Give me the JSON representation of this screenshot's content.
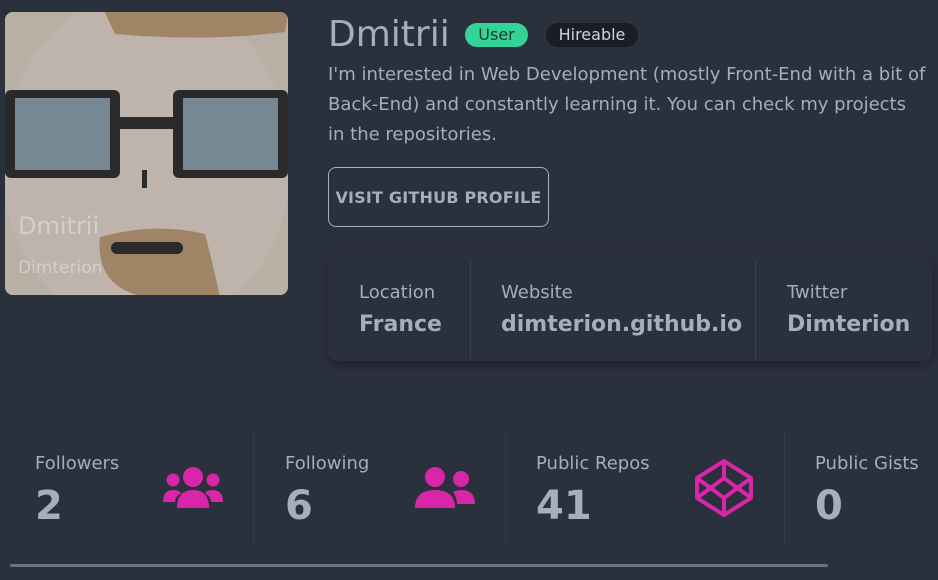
{
  "profile": {
    "name": "Dmitrii",
    "login": "Dimterion",
    "badges": {
      "type": "User",
      "hireable": "Hireable"
    },
    "bio": "I'm interested in Web Development (mostly Front-End with a bit of Back-End) and constantly learning it. You can check my projects in the repositories.",
    "github_button": "VISIT GITHUB PROFILE"
  },
  "info": [
    {
      "label": "Location",
      "value": "France"
    },
    {
      "label": "Website",
      "value": "dimterion.github.io"
    },
    {
      "label": "Twitter",
      "value": "Dimterion"
    }
  ],
  "stats": [
    {
      "label": "Followers",
      "value": "2",
      "icon": "users-icon"
    },
    {
      "label": "Following",
      "value": "6",
      "icon": "user-friends-icon"
    },
    {
      "label": "Public Repos",
      "value": "41",
      "icon": "codepen-icon"
    },
    {
      "label": "Public Gists",
      "value": "0",
      "icon": "store-icon"
    }
  ],
  "colors": {
    "background": "#2a303c",
    "accent": "#d926a9",
    "success_badge": "#36d399",
    "dark_badge": "#191d24"
  }
}
